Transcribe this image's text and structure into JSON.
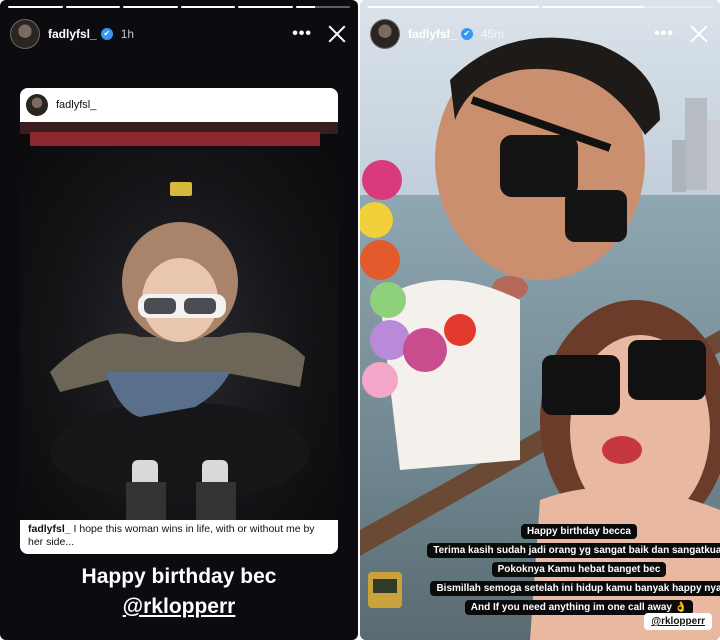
{
  "left_story": {
    "progress": [
      1,
      1,
      1,
      1,
      1,
      0.35
    ],
    "username": "fadlyfsl_",
    "time": "1h",
    "repost": {
      "username": "fadlyfsl_",
      "caption_user": "fadlyfsl_",
      "caption_text": "I hope this woman wins in life, with or without me by her side..."
    },
    "headline": "Happy birthday bec",
    "mention": "@rklopperr"
  },
  "right_story": {
    "progress": [
      1,
      0.6
    ],
    "username": "fadlyfsl_",
    "time": "45m",
    "captions": [
      "Happy birthday becca",
      "Terima kasih sudah jadi orang yg sangat baik dan sangatkuat",
      "Pokoknya Kamu hebat banget bec",
      "Bismillah semoga setelah ini hidup kamu banyak happy nya",
      "And If you need anything im one call away 👌"
    ],
    "mention": "@rklopperr"
  },
  "icons": {
    "verified": "verified-badge-icon",
    "more": "more-options-icon",
    "close": "close-icon"
  },
  "colors": {
    "verified": "#3897f0",
    "left_bg": "#0c0c10",
    "caption_bg": "#0a0a0a"
  }
}
